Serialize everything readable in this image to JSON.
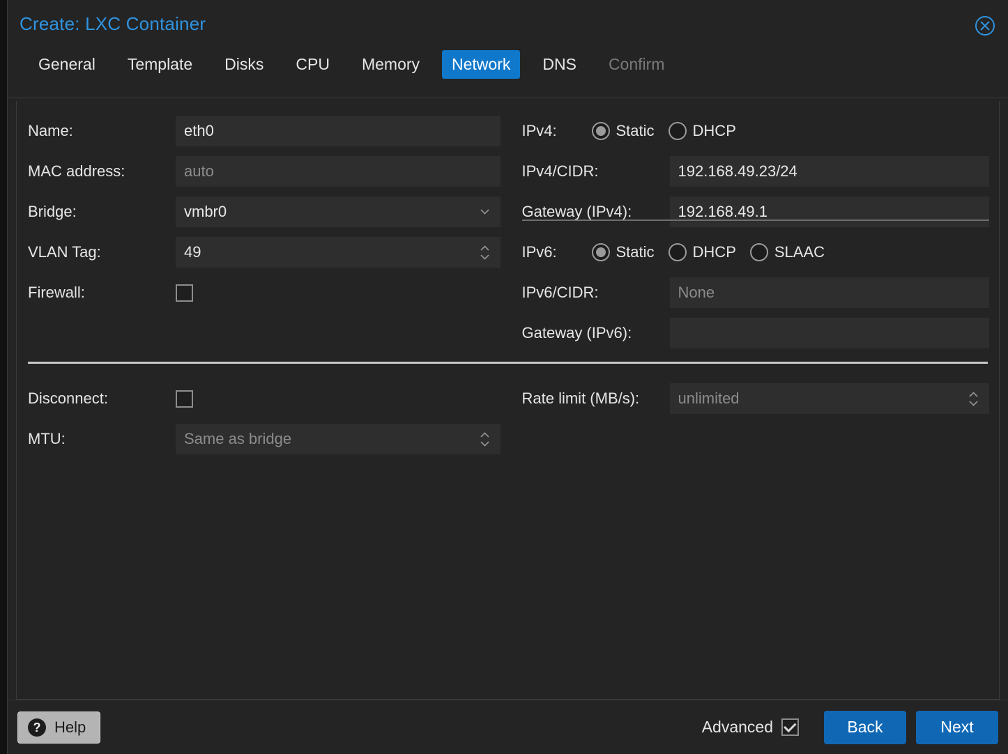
{
  "dialog": {
    "title": "Create: LXC Container",
    "close_icon": "close-circle-icon"
  },
  "tabs": [
    {
      "label": "General",
      "state": "normal"
    },
    {
      "label": "Template",
      "state": "normal"
    },
    {
      "label": "Disks",
      "state": "normal"
    },
    {
      "label": "CPU",
      "state": "normal"
    },
    {
      "label": "Memory",
      "state": "normal"
    },
    {
      "label": "Network",
      "state": "active"
    },
    {
      "label": "DNS",
      "state": "normal"
    },
    {
      "label": "Confirm",
      "state": "disabled"
    }
  ],
  "left": {
    "name_label": "Name:",
    "name_value": "eth0",
    "mac_label": "MAC address:",
    "mac_placeholder": "auto",
    "bridge_label": "Bridge:",
    "bridge_value": "vmbr0",
    "vlan_label": "VLAN Tag:",
    "vlan_value": "49",
    "firewall_label": "Firewall:",
    "firewall_checked": false,
    "disconnect_label": "Disconnect:",
    "disconnect_checked": false,
    "mtu_label": "MTU:",
    "mtu_placeholder": "Same as bridge"
  },
  "right": {
    "ipv4_label": "IPv4:",
    "ipv4_options": [
      {
        "label": "Static",
        "selected": true
      },
      {
        "label": "DHCP",
        "selected": false
      }
    ],
    "ipv4_cidr_label": "IPv4/CIDR:",
    "ipv4_cidr_value": "192.168.49.23/24",
    "gw4_label": "Gateway (IPv4):",
    "gw4_value": "192.168.49.1",
    "ipv6_label": "IPv6:",
    "ipv6_options": [
      {
        "label": "Static",
        "selected": true
      },
      {
        "label": "DHCP",
        "selected": false
      },
      {
        "label": "SLAAC",
        "selected": false
      }
    ],
    "ipv6_cidr_label": "IPv6/CIDR:",
    "ipv6_cidr_placeholder": "None",
    "gw6_label": "Gateway (IPv6):",
    "gw6_value": "",
    "rate_label": "Rate limit (MB/s):",
    "rate_placeholder": "unlimited"
  },
  "footer": {
    "help_label": "Help",
    "help_icon": "question-mark-icon",
    "advanced_label": "Advanced",
    "advanced_checked": true,
    "back_label": "Back",
    "next_label": "Next"
  },
  "colors": {
    "accent": "#1078cb",
    "title": "#2f93e0",
    "button": "#1068b5",
    "panel": "#242424",
    "field": "#2e2e2e"
  }
}
